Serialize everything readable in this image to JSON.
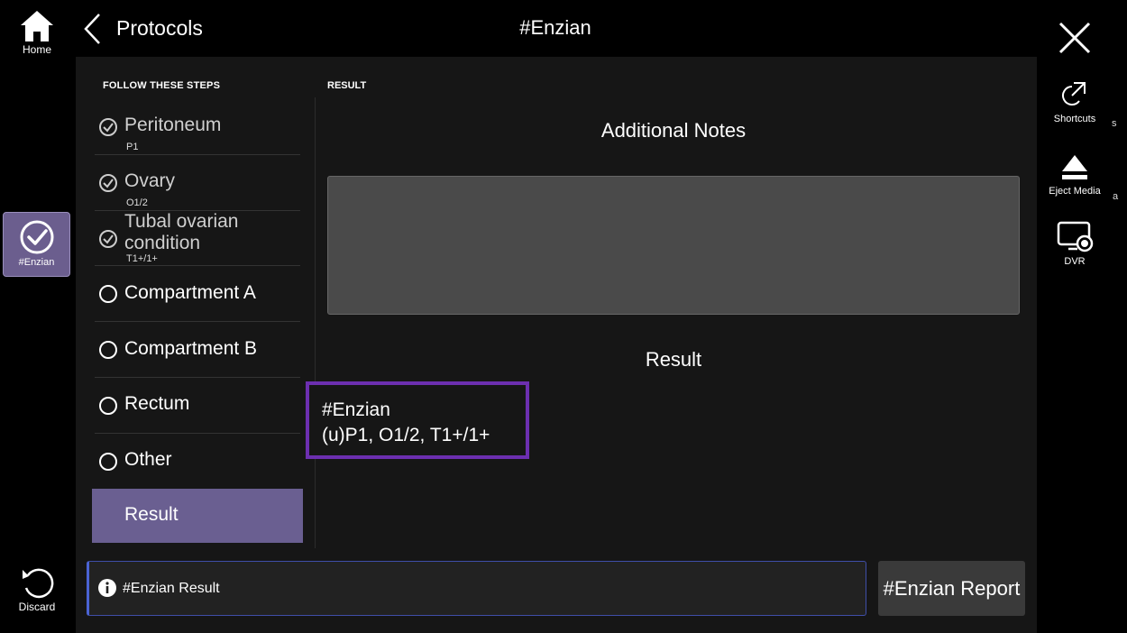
{
  "left_rail": {
    "home_label": "Home",
    "enzian_label": "#Enzian",
    "discard_label": "Discard"
  },
  "header": {
    "back_label": "Protocols",
    "title": "#Enzian"
  },
  "right_rail": {
    "shortcuts_label": "Shortcuts",
    "eject_label": "Eject Media",
    "dvr_label": "DVR",
    "frag1": "s",
    "frag2": "a"
  },
  "steps": {
    "heading": "FOLLOW THESE STEPS",
    "items": [
      {
        "name": "Peritoneum",
        "sub": "P1",
        "done": true
      },
      {
        "name": "Ovary",
        "sub": "O1/2",
        "done": true
      },
      {
        "name": "Tubal ovarian",
        "name2": "condition",
        "sub": "T1+/1+",
        "done": true
      },
      {
        "name": "Compartment A",
        "done": false
      },
      {
        "name": "Compartment B",
        "done": false
      },
      {
        "name": "Rectum",
        "done": false
      },
      {
        "name": "Other",
        "done": false
      },
      {
        "name": "Result",
        "active": true
      }
    ]
  },
  "result": {
    "heading": "RESULT",
    "notes_title": "Additional Notes",
    "notes_value": "",
    "result_title": "Result",
    "result_line1": "#Enzian",
    "result_line2": "(u)P1, O1/2, T1+/1+"
  },
  "footer": {
    "info_text": "#Enzian Result",
    "report_button": "#Enzian Report"
  },
  "colors": {
    "accent_purple": "#6a5f91",
    "highlight_border": "#6c2fb0",
    "info_border": "#4b63d4"
  }
}
